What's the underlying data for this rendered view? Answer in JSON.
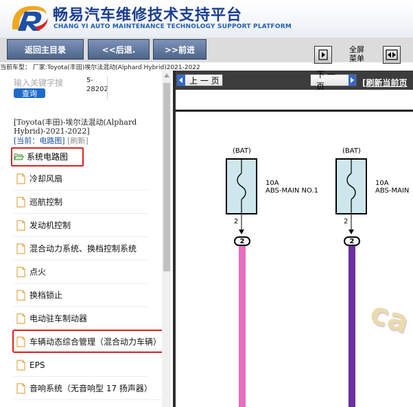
{
  "brand": {
    "title": "畅易汽车维修技术支持平台",
    "subtitle": "CHANG YI AUTO MAINTENANCE TECHNOLOGY SUPPORT PLATFORM"
  },
  "toolbar": {
    "main_label": "返回主目录",
    "back_label": "<<后退.",
    "forward_label": ">>前进",
    "fullscreen_label_1": "全屏",
    "fullscreen_label_2": "菜单"
  },
  "car_info": "当前车型：  厂家:Toyota(丰田)埃尔法混动(Alphard Hybrid)2021-2022",
  "left": {
    "search_placeholder": "输入关键字搜",
    "search_button": "查询",
    "code": "5-\n28202",
    "vehicle": "[Toyota(丰田)-埃尔法混动(Alphard Hybrid)-2021-2022]",
    "current_label": "[当前：电路图]",
    "refresh_label": "[刷新]",
    "root_item": "系统电路图",
    "items": [
      "冷却风扇",
      "巡航控制",
      "发动机控制",
      "混合动力系统、换档控制系统",
      "点火",
      "换档锁止",
      "电动驻车制动器",
      "车辆动态综合管理（混合动力车辆）",
      "EPS",
      "音响系统（无音响型 17 扬声器）"
    ]
  },
  "right": {
    "prev_label": "上 一 页",
    "next_label": "下 一 页",
    "refresh_label": "[刷新当前页"
  },
  "diagram": {
    "bat_1": "(BAT)",
    "bat_2": "(BAT)",
    "fuse_1_amp": "10A",
    "fuse_1_name": "ABS-MAIN NO.1",
    "fuse_2_amp": "10A",
    "fuse_2_name": "ABS-MAIN",
    "pin_1": "2",
    "pin_2": "2",
    "conn_1": "2",
    "conn_2": "2",
    "wire_1_color": "#e86cc0",
    "wire_2_color": "#6a2fa0",
    "watermark": "ca"
  },
  "icons": {
    "logo": "logo-icon",
    "fullscreen_a": "collapse-panel-icon",
    "fullscreen_b": "expand-panel-icon",
    "folder": "folder-open-icon",
    "document": "document-icon"
  }
}
